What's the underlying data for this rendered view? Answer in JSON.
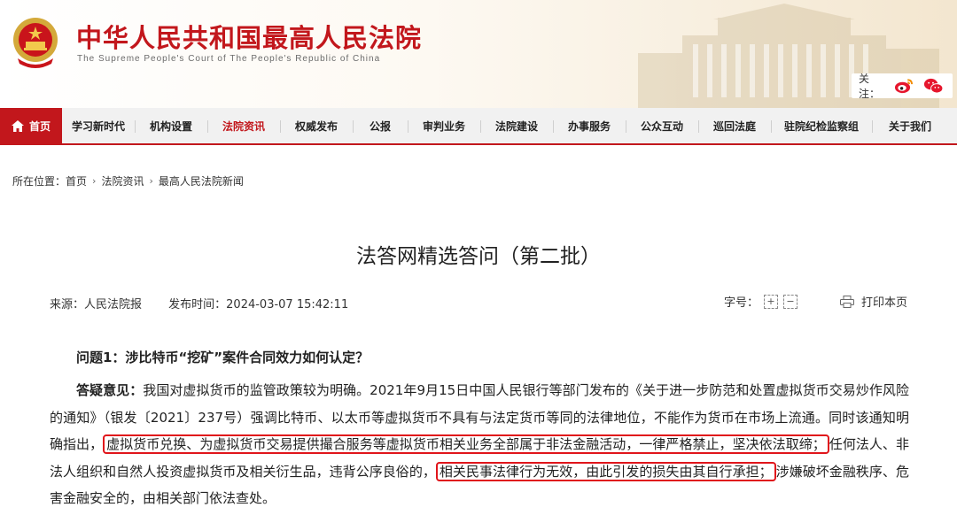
{
  "header": {
    "title": "中华人民共和国最高人民法院",
    "subtitle": "The Supreme People's Court of The People's Republic of China",
    "follow_label": "关注：",
    "icons": [
      "national-emblem",
      "weibo-icon",
      "wechat-icon"
    ]
  },
  "nav": {
    "home": "首页",
    "items": [
      "学习新时代",
      "机构设置",
      "法院资讯",
      "权威发布",
      "公报",
      "审判业务",
      "法院建设",
      "办事服务",
      "公众互动",
      "巡回法庭",
      "驻院纪检监察组",
      "关于我们"
    ],
    "active": "法院资讯"
  },
  "breadcrumb": {
    "prefix": "所在位置：",
    "items": [
      "首页",
      "法院资讯",
      "最高人民法院新闻"
    ]
  },
  "article": {
    "title": "法答网精选答问（第二批）",
    "source": "来源：人民法院报",
    "published": "发布时间：2024-03-07 15:42:11",
    "font_size_label": "字号：",
    "font_increase": "+",
    "font_decrease": "−",
    "print_label": "打印本页",
    "question": "问题1：涉比特币“挖矿”案件合同效力如何认定？",
    "answer_lead": "答疑意见：",
    "answer_part1": "我国对虚拟货币的监管政策较为明确。2021年9月15日中国人民银行等部门发布的《关于进一步防范和处置虚拟货币交易炒作风险的通知》（银发〔2021〕237号）强调比特币、以太币等虚拟货币不具有与法定货币等同的法律地位，不能作为货币在市场上流通。同时该通知明确指出，",
    "answer_highlight1": "虚拟货币兑换、为虚拟货币交易提供撮合服务等虚拟货币相关业务全部属于非法金融活动，一律严格禁止，坚决依法取缔；",
    "answer_part2": "任何法人、非法人组织和自然人投资虚拟货币及相关衍生品，违背公序良俗的，",
    "answer_highlight2": "相关民事法律行为无效，由此引发的损失由其自行承担；",
    "answer_part3": "涉嫌破坏金融秩序、危害金融安全的，由相关部门依法查处。"
  },
  "colors": {
    "brand_red": "#c2171c",
    "highlight_border": "#e0151b",
    "nav_bg": "#f1f1f1"
  }
}
